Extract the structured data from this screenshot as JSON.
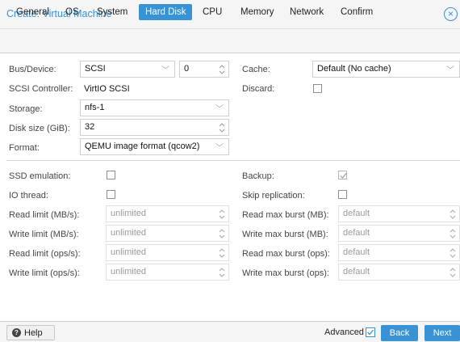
{
  "dialog": {
    "title": "Create: Virtual Machine"
  },
  "tabs": [
    "General",
    "OS",
    "System",
    "Hard Disk",
    "CPU",
    "Memory",
    "Network",
    "Confirm"
  ],
  "left": {
    "bus_label": "Bus/Device:",
    "bus_value": "SCSI",
    "device_index": "0",
    "controller_label": "SCSI Controller:",
    "controller_value": "VirtIO SCSI",
    "storage_label": "Storage:",
    "storage_value": "nfs-1",
    "disk_size_label": "Disk size (GiB):",
    "disk_size_value": "32",
    "format_label": "Format:",
    "format_value": "QEMU image format (qcow2)"
  },
  "right": {
    "cache_label": "Cache:",
    "cache_value": "Default (No cache)",
    "discard_label": "Discard:"
  },
  "advanced": {
    "ssd_label": "SSD emulation:",
    "io_thread_label": "IO thread:",
    "read_limit_mb_label": "Read limit (MB/s):",
    "write_limit_mb_label": "Write limit (MB/s):",
    "read_limit_ops_label": "Read limit (ops/s):",
    "write_limit_ops_label": "Write limit (ops/s):",
    "limit_placeholder": "unlimited",
    "backup_label": "Backup:",
    "skip_replication_label": "Skip replication:",
    "read_burst_mb_label": "Read max burst (MB):",
    "write_burst_mb_label": "Write max burst (MB):",
    "read_burst_ops_label": "Read max burst (ops):",
    "write_burst_ops_label": "Write max burst (ops):",
    "burst_placeholder": "default"
  },
  "footer": {
    "help_label": "Help",
    "advanced_label": "Advanced",
    "back_label": "Back",
    "next_label": "Next"
  },
  "checkbox_state": {
    "discard": false,
    "ssd_emulation": false,
    "io_thread": false,
    "backup": true,
    "skip_replication": false,
    "advanced": true
  },
  "icons": [
    "close-icon",
    "help-icon",
    "chevron-down-icon",
    "spinner-icon",
    "checkbox-icon"
  ],
  "colors": {
    "accent": "#3892d4",
    "border": "#cfcfcf",
    "disabled_text": "#9a9a9a"
  }
}
